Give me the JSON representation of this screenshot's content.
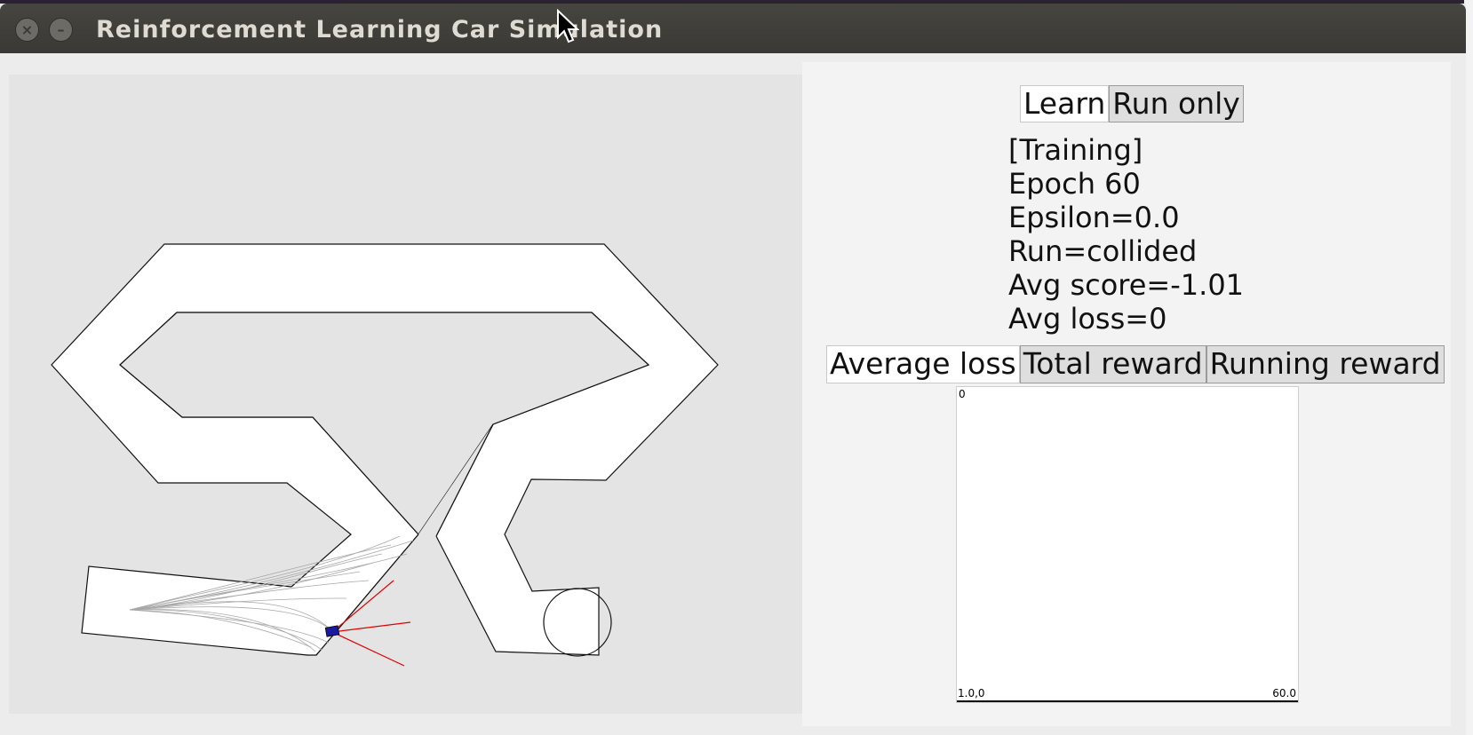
{
  "window": {
    "title": "Reinforcement Learning Car Simulation",
    "close_glyph": "×",
    "minimize_glyph": "–"
  },
  "desktop": {
    "background_text": ""
  },
  "controls": {
    "learn_label": "Learn",
    "run_only_label": "Run only",
    "active_mode": "Learn"
  },
  "status": {
    "mode": "[Training]",
    "epoch": "Epoch 60",
    "epsilon": "Epsilon=0.0",
    "run": "Run=collided",
    "avg_score": "Avg score=-1.01",
    "avg_loss": "Avg loss=0"
  },
  "graph_tabs": {
    "average_loss": "Average loss",
    "total_reward": "Total reward",
    "running_reward": "Running reward",
    "active": "Average loss"
  },
  "graph": {
    "y_top_label": "0",
    "x_min_label": "1.0,0",
    "x_max_label": "60.0"
  },
  "colors": {
    "sensor_ray": "#e00000",
    "car": "#1a1aa0",
    "trail": "#a8a8a8",
    "track": "#ffffff"
  }
}
